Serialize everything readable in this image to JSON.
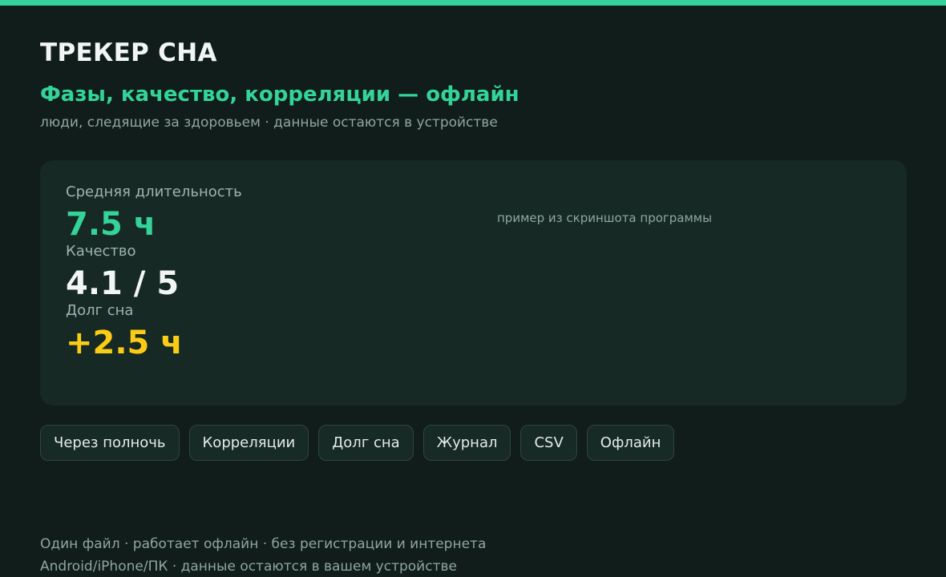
{
  "colors": {
    "background": "#101d1a",
    "accent": "#34d399",
    "card": "#172924",
    "warning": "#facc15",
    "text": "#f1f5f4",
    "muted": "#8fa6a0"
  },
  "header": {
    "title": "ТРЕКЕР СНА",
    "subtitle": "Фазы, качество, корреляции — офлайн",
    "tagline": "люди, следящие за здоровьем · данные остаются в устройстве"
  },
  "stats": [
    {
      "label": "Средняя длительность",
      "value": "7.5 ч",
      "color": "#34d399"
    },
    {
      "label": "Качество",
      "value": "4.1 / 5",
      "color": "#f1f5f4"
    },
    {
      "label": "Долг сна",
      "value": "+2.5 ч",
      "color": "#facc15"
    }
  ],
  "card_note": "пример из скриншота программы",
  "features": [
    "Через полночь",
    "Корреляции",
    "Долг сна",
    "Журнал",
    "CSV",
    "Офлайн"
  ],
  "footer": {
    "line1": "Один файл · работает офлайн · без регистрации и интернета",
    "line2": "Android/iPhone/ПК · данные остаются в вашем устройстве"
  }
}
